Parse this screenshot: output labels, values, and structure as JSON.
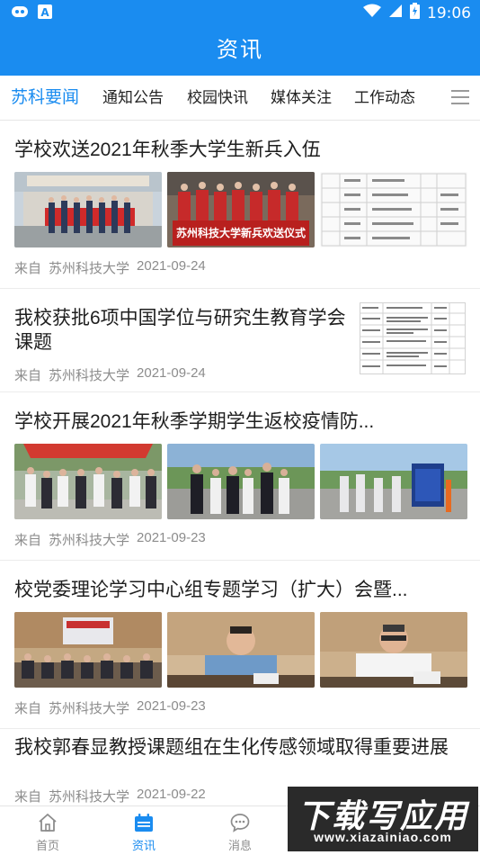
{
  "status_bar": {
    "time": "19:06",
    "icons": [
      "game-controller-icon",
      "a-letter-icon",
      "wifi-icon",
      "signal-icon",
      "battery-charging-icon"
    ]
  },
  "header": {
    "title": "资讯"
  },
  "tabs": [
    {
      "label": "苏科要闻",
      "active": true
    },
    {
      "label": "通知公告",
      "active": false
    },
    {
      "label": "校园快讯",
      "active": false
    },
    {
      "label": "媒体关注",
      "active": false
    },
    {
      "label": "工作动态",
      "active": false
    }
  ],
  "tabs_menu_icon": "menu-lines-icon",
  "articles": [
    {
      "title": "学校欢送2021年秋季大学生新兵入伍",
      "source_prefix": "来自",
      "source": "苏州科技大学",
      "date": "2021-09-24",
      "layout": "three-images",
      "image_captions": [
        "苏州科技大学新兵欢送仪式"
      ]
    },
    {
      "title": "我校获批6项中国学位与研究生教育学会课题",
      "source_prefix": "来自",
      "source": "苏州科技大学",
      "date": "2021-09-24",
      "layout": "side-image"
    },
    {
      "title": "学校开展2021年秋季学期学生返校疫情防...",
      "source_prefix": "来自",
      "source": "苏州科技大学",
      "date": "2021-09-23",
      "layout": "three-images"
    },
    {
      "title": "校党委理论学习中心组专题学习（扩大）会暨...",
      "source_prefix": "来自",
      "source": "苏州科技大学",
      "date": "2021-09-23",
      "layout": "three-images"
    },
    {
      "title": "我校郭春显教授课题组在生化传感领域取得重要进展",
      "source_prefix": "来自",
      "source": "苏州科技大学",
      "date": "2021-09-22",
      "layout": "text-only"
    }
  ],
  "bottom_nav": [
    {
      "label": "首页",
      "icon": "home-icon",
      "active": false
    },
    {
      "label": "资讯",
      "icon": "news-calendar-icon",
      "active": true
    },
    {
      "label": "消息",
      "icon": "chat-bubble-icon",
      "active": false
    }
  ],
  "watermark": {
    "title": "下载写应用",
    "url": "www.xiazainiao.com"
  },
  "colors": {
    "primary": "#1a8cf0",
    "text": "#1e1e1e",
    "meta": "#8c8c8c"
  }
}
